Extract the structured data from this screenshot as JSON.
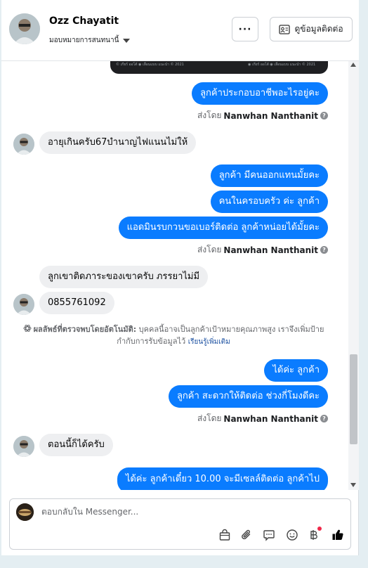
{
  "header": {
    "name": "Ozz Chayatit",
    "assign_label": "มอบหมายการสนทนานี้",
    "more_label": "···",
    "contact_label": "ดูข้อมูลติดต่อ"
  },
  "top_image": {
    "caption_left": "© เกียร์ ออโต้   ◉ เลื่อนแบบ แนะนำ   © 2021",
    "caption_right": "◉ เกียร์ ออโต้   ◉ เลื่อนแบบ แนะนำ   © 2021"
  },
  "messages": {
    "m1": "ลูกค้าประกอบอาชีพอะไรอยู่คะ",
    "m2": "อายุเกินครับ67บำนาญไฟแนนไม่ให้",
    "m3": "ลูกค้า มีคนออกแทนมั้ยคะ",
    "m4": "คนในครอบครัว ค่ะ ลูกค้า",
    "m5": "แอดมินรบกวนขอเบอร์ติดต่อ ลูกค้าหน่อยได้มั้ยคะ",
    "m6": "ลูกเขาติดภาระของเขาครับ ภรรยาไม่มี",
    "m7": "0855761092",
    "m8": "ได้ค่ะ ลูกค้า",
    "m9": "ลูกค้า สะดวกให้ติดต่อ ช่วงกี่โมงดีคะ",
    "m10": "ตอนนี้ก็ได้ครับ",
    "m11": "ได้ค่ะ ลูกค้าเดี๋ยว 10.00 จะมีเซลล์ติดต่อ ลูกค้าไป"
  },
  "sent_by": {
    "prefix": "ส่งโดย",
    "name": "Nanwhan Nanthanit"
  },
  "ai_note": {
    "head": "ผลลัพธ์ที่ตรวจพบโดยอัตโนมัติ:",
    "body": " บุคคลนี้อาจเป็นลูกค้าเป้าหมายคุณภาพสูง เราจึงเพิ่มป้ายกำกับการรับข้อมูลไว้ ",
    "link": "เรียนรู้เพิ่มเติม"
  },
  "composer": {
    "placeholder": "ตอบกลับใน Messenger..."
  },
  "colors": {
    "outgoing_bubble": "#0a7cff",
    "incoming_bubble": "#eeeff1",
    "like_icon": "#050505",
    "notification_dot": "#f02849"
  },
  "icons": [
    "more-icon",
    "contact-card-icon",
    "caret-down-icon",
    "question-icon",
    "ai-detect-icon",
    "shopping-bag-icon",
    "attachment-icon",
    "saved-reply-icon",
    "emoji-icon",
    "baht-icon",
    "like-icon"
  ]
}
